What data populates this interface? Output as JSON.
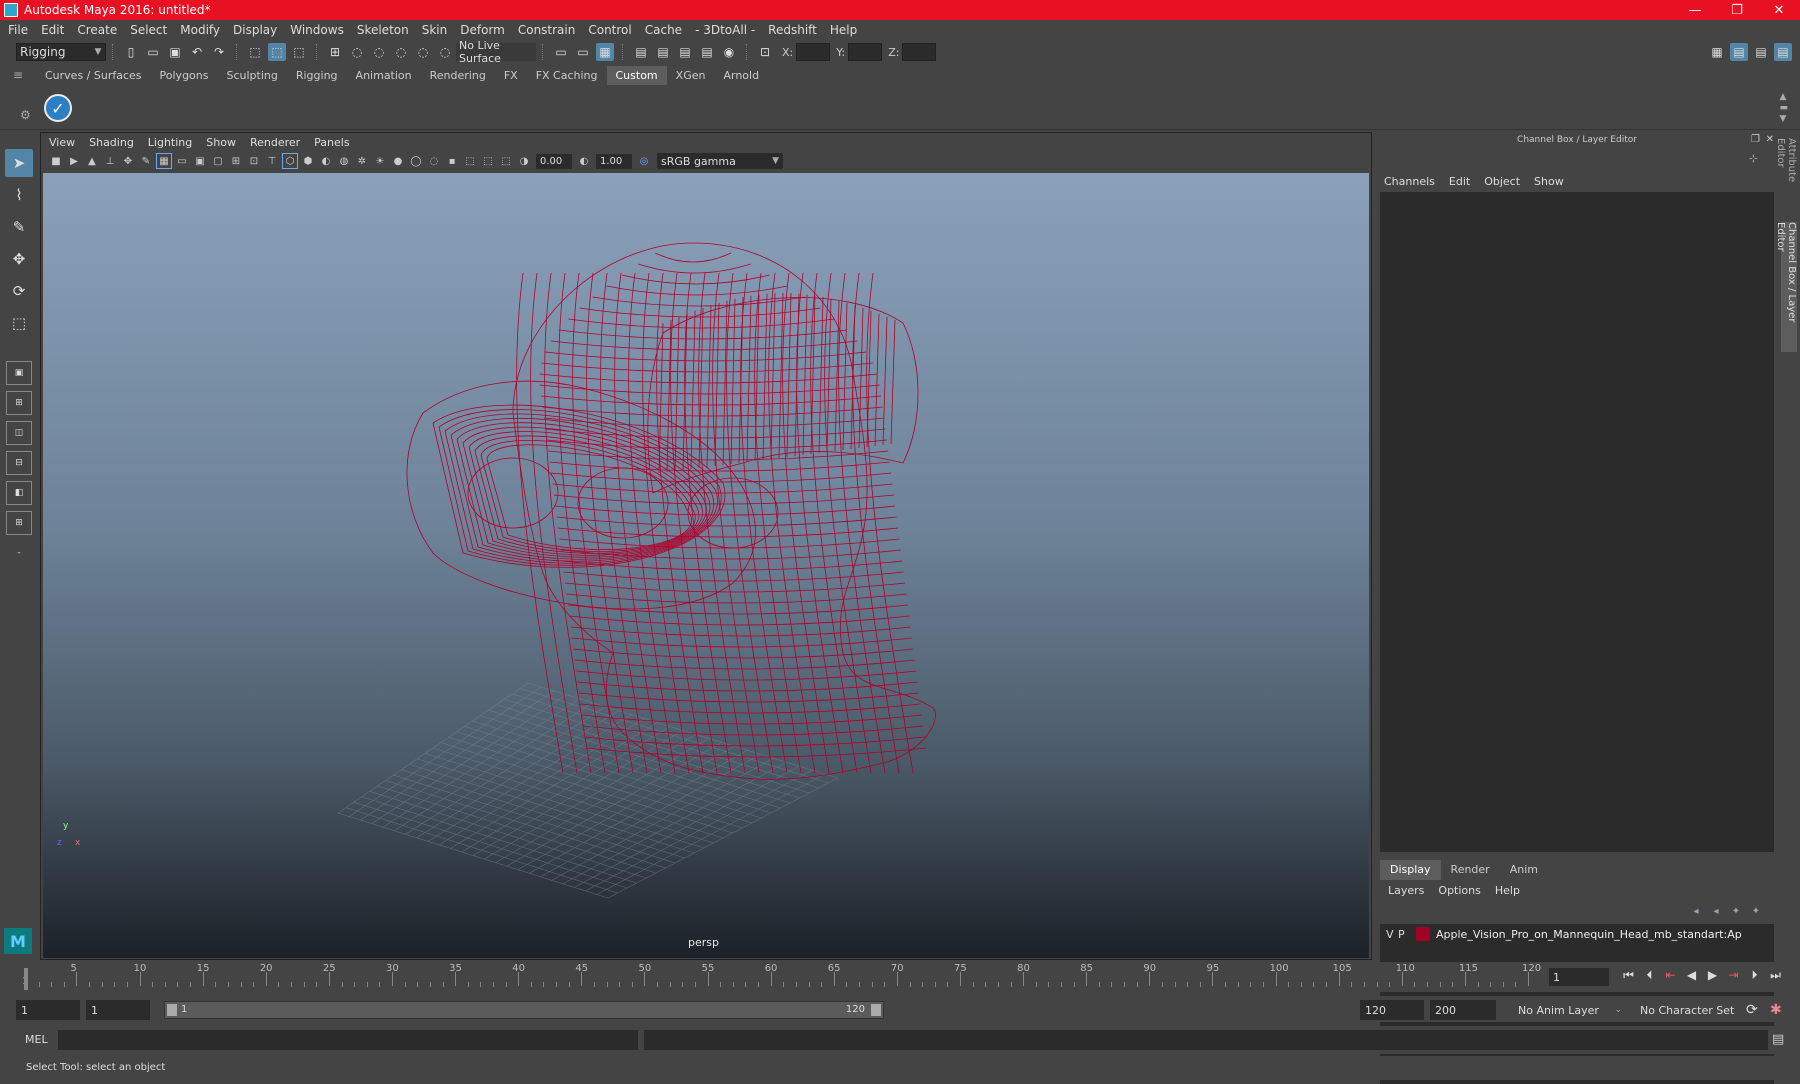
{
  "window": {
    "title": "Autodesk Maya 2016: untitled*",
    "minimize": "—",
    "maximize": "❐",
    "close": "✕"
  },
  "menubar": [
    "File",
    "Edit",
    "Create",
    "Select",
    "Modify",
    "Display",
    "Windows",
    "Skeleton",
    "Skin",
    "Deform",
    "Constrain",
    "Control",
    "Cache",
    "- 3DtoAll -",
    "Redshift",
    "Help"
  ],
  "statusline": {
    "mode": "Rigging",
    "live_surface": "No Live Surface",
    "x_label": "X:",
    "y_label": "Y:",
    "z_label": "Z:"
  },
  "shelf_tabs": [
    "Curves / Surfaces",
    "Polygons",
    "Sculpting",
    "Rigging",
    "Animation",
    "Rendering",
    "FX",
    "FX Caching",
    "Custom",
    "XGen",
    "Arnold"
  ],
  "shelf_active_tab": "Custom",
  "viewport": {
    "menus": [
      "View",
      "Shading",
      "Lighting",
      "Show",
      "Renderer",
      "Panels"
    ],
    "exposure": "0.00",
    "gamma": "1.00",
    "color_space": "sRGB gamma",
    "camera": "persp",
    "axis_y": "y",
    "axis_x": "x",
    "axis_z": "z",
    "wire_color": "#b0002b"
  },
  "channel_box": {
    "title": "Channel Box / Layer Editor",
    "menus": [
      "Channels",
      "Edit",
      "Object",
      "Show"
    ]
  },
  "layer_editor": {
    "tabs": [
      "Display",
      "Render",
      "Anim"
    ],
    "active_tab": "Display",
    "menus": [
      "Layers",
      "Options",
      "Help"
    ],
    "layers": [
      {
        "v": "V",
        "p": "P",
        "name": "Apple_Vision_Pro_on_Mannequin_Head_mb_standart:Ap",
        "color": "#a00024"
      }
    ]
  },
  "side_tabs": [
    "Attribute Editor",
    "Channel Box / Layer Editor"
  ],
  "timeline": {
    "ticks": [
      "1",
      "5",
      "10",
      "15",
      "20",
      "25",
      "30",
      "35",
      "40",
      "45",
      "50",
      "55",
      "60",
      "65",
      "70",
      "75",
      "80",
      "85",
      "90",
      "95",
      "100",
      "105",
      "110",
      "115",
      "120"
    ],
    "current_frame": "1"
  },
  "range": {
    "start": "1",
    "playback_start": "1",
    "bar_start": "1",
    "bar_end": "120",
    "playback_end": "120",
    "end": "200",
    "anim_layer": "No Anim Layer",
    "character_set": "No Character Set"
  },
  "command_line": {
    "lang": "MEL"
  },
  "help_line": "Select Tool: select an object"
}
